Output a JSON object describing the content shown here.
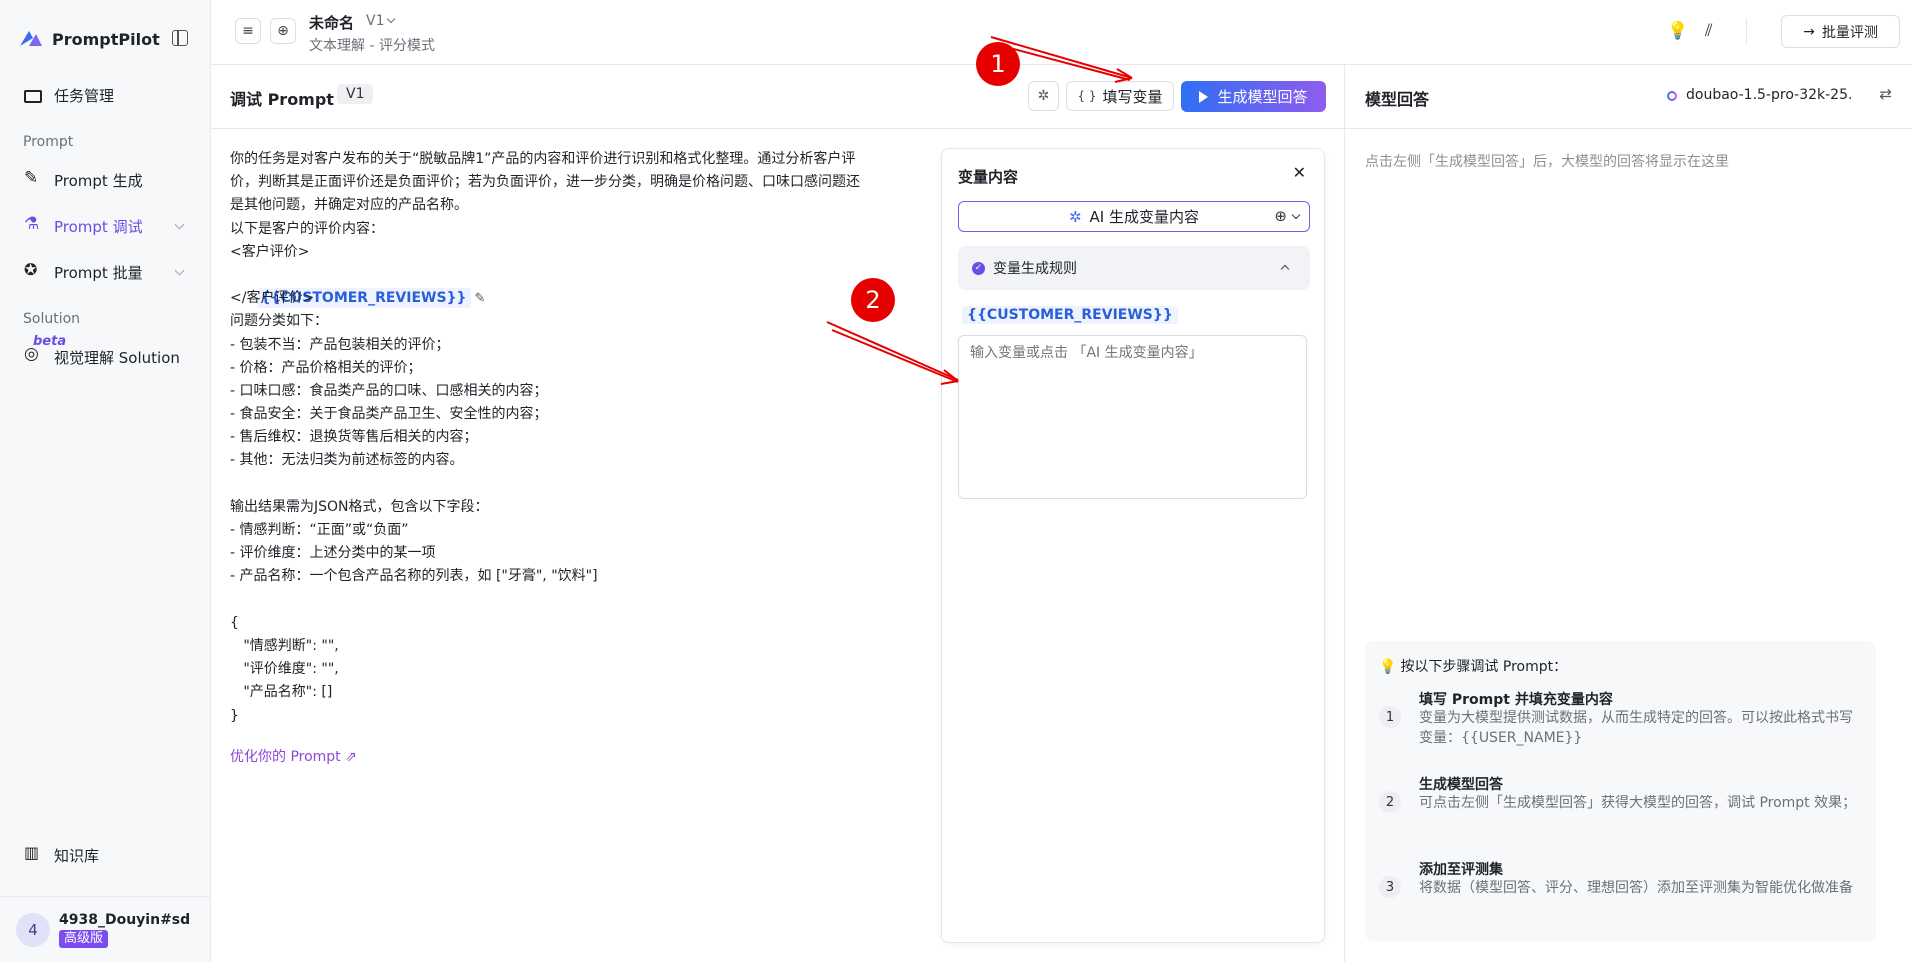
{
  "app": {
    "name": "PromptPilot"
  },
  "sidebar": {
    "items": [
      {
        "label": "任务管理",
        "icon": "folder-icon"
      },
      {
        "label": "Prompt 生成",
        "icon": "pen-icon"
      },
      {
        "label": "Prompt 调试",
        "icon": "flask-icon",
        "active": true
      },
      {
        "label": "Prompt 批量",
        "icon": "star-icon"
      },
      {
        "label": "视觉理解 Solution",
        "icon": "eye-icon"
      },
      {
        "label": "知识库",
        "icon": "book-icon"
      }
    ],
    "section_prompt": "Prompt",
    "section_solution": "Solution",
    "beta": "beta",
    "user": {
      "avatar": "4",
      "name": "4938_Douyin#sd...",
      "badge": "高级版"
    }
  },
  "topbar": {
    "title": "未命名",
    "version": "V1",
    "subtitle": "文本理解 - 评分模式",
    "batch_label": "批量评测"
  },
  "debug": {
    "title": "调试 Prompt",
    "version": "V1",
    "fill_label": "填写变量",
    "generate_label": "生成模型回答",
    "prompt_lines": [
      "你的任务是对客户发布的关于“脱敏品牌1”产品的内容和评价进行识别和格式化整理。通过分析客户评",
      "价，判断其是正面评价还是负面评价；若为负面评价，进一步分类，明确是价格问题、口味口感问题还",
      "是其他问题，并确定对应的产品名称。",
      "以下是客户的评价内容：",
      "<客户评价>",
      "</客户评价>",
      "问题分类如下：",
      "- 包装不当：产品包装相关的评价；",
      "- 价格：产品价格相关的评价；",
      "- 口味口感：食品类产品的口味、口感相关的内容；",
      "- 食品安全：关于食品类产品卫生、安全性的内容；",
      "- 售后维权：退换货等售后相关的内容；",
      "- 其他：无法归类为前述标签的内容。",
      "",
      "输出结果需为JSON格式，包含以下字段：",
      "- 情感判断：“正面”或“负面”",
      "- 评价维度：上述分类中的某一项",
      "- 产品名称：一个包含产品名称的列表，如 [\"牙膏\", \"饮料\"]",
      "",
      "{",
      "   \"情感判断\": \"\",",
      "   \"评价维度\": \"\",",
      "   \"产品名称\": []",
      "}"
    ],
    "variable_chip": "{{CUSTOMER_REVIEWS}}",
    "optimize_label": "优化你的 Prompt"
  },
  "variables": {
    "title": "变量内容",
    "ai_generate_label": "AI 生成变量内容",
    "rule_label": "变量生成规则",
    "var_name": "{{CUSTOMER_REVIEWS}}",
    "placeholder": "输入变量或点击 「AI 生成变量内容」"
  },
  "response": {
    "title": "模型回答",
    "model": "doubao-1.5-pro-32k-25...",
    "hint": "点击左侧「生成模型回答」后，大模型的回答将显示在这里",
    "steps_title": "按以下步骤调试 Prompt：",
    "steps": [
      {
        "num": "1",
        "title": "填写 Prompt 并填充变量内容",
        "desc": "变量为大模型提供测试数据，从而生成特定的回答。可以按此格式书写变量：{{USER_NAME}}"
      },
      {
        "num": "2",
        "title": "生成模型回答",
        "desc": "可点击左侧「生成模型回答」获得大模型的回答，调试 Prompt 效果；"
      },
      {
        "num": "3",
        "title": "添加至评测集",
        "desc": "将数据（模型回答、评分、理想回答）添加至评测集为智能优化做准备"
      }
    ]
  },
  "annotations": {
    "one": "1",
    "two": "2"
  },
  "colors": {
    "accent": "#6b4ce6",
    "primary_gradient_start": "#2f6ff2",
    "primary_gradient_end": "#8f5cf0",
    "annotation": "#e60000"
  }
}
